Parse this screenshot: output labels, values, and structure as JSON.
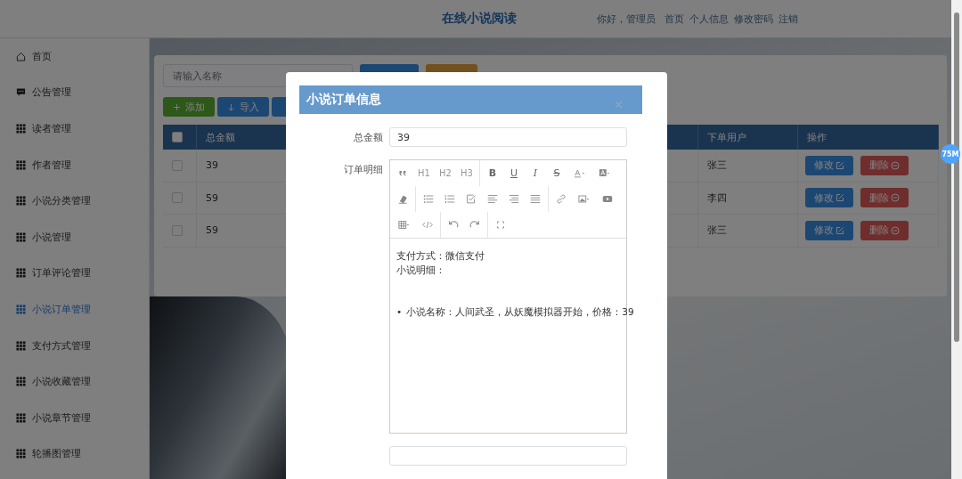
{
  "header": {
    "title": "在线小说阅读",
    "greeting": "你好，管理员",
    "links": [
      "首页",
      "个人信息",
      "修改密码",
      "注销"
    ]
  },
  "sidebar": {
    "items": [
      {
        "label": "首页",
        "kind": "home",
        "selected": false
      },
      {
        "label": "公告管理",
        "kind": "chat",
        "selected": false
      },
      {
        "label": "读者管理",
        "kind": "grid",
        "selected": false
      },
      {
        "label": "作者管理",
        "kind": "grid",
        "selected": false
      },
      {
        "label": "小说分类管理",
        "kind": "grid",
        "selected": false
      },
      {
        "label": "小说管理",
        "kind": "grid",
        "selected": false
      },
      {
        "label": "订单评论管理",
        "kind": "grid",
        "selected": false
      },
      {
        "label": "小说订单管理",
        "kind": "grid",
        "selected": true
      },
      {
        "label": "支付方式管理",
        "kind": "grid",
        "selected": false
      },
      {
        "label": "小说收藏管理",
        "kind": "grid",
        "selected": false
      },
      {
        "label": "小说章节管理",
        "kind": "grid",
        "selected": false
      },
      {
        "label": "轮播图管理",
        "kind": "grid",
        "selected": false
      }
    ]
  },
  "search": {
    "placeholder": "请输入名称",
    "buttons": [
      {
        "kind": "query"
      },
      {
        "kind": "reset"
      }
    ]
  },
  "toolbar": [
    {
      "kind": "add",
      "label": "添加"
    },
    {
      "kind": "import",
      "label": "导入"
    },
    {
      "kind": "export"
    }
  ],
  "table": {
    "columns": [
      "总金额",
      "下单用户",
      "操作"
    ],
    "select_all_checked": false,
    "rows": [
      {
        "checked": false,
        "amount": "39",
        "user": "张三",
        "actions": [
          {
            "kind": "edit",
            "label": "修改"
          },
          {
            "kind": "delete",
            "label": "删除"
          }
        ]
      },
      {
        "checked": false,
        "amount": "59",
        "user": "李四",
        "actions": [
          {
            "kind": "edit",
            "label": "修改"
          },
          {
            "kind": "delete",
            "label": "删除"
          }
        ]
      },
      {
        "checked": false,
        "amount": "59",
        "user": "张三",
        "actions": [
          {
            "kind": "edit",
            "label": "修改"
          },
          {
            "kind": "delete",
            "label": "删除"
          }
        ]
      }
    ]
  },
  "dialog": {
    "title": "小说订单信息",
    "fields": [
      {
        "label": "总金额",
        "kind": "input",
        "value": "39"
      },
      {
        "label": "订单明细",
        "kind": "editor"
      },
      {
        "kind": "input"
      }
    ],
    "editor": {
      "toolbar": [
        {
          "kind": "quote"
        },
        {
          "kind": "heading",
          "label": "H1"
        },
        {
          "kind": "heading",
          "label": "H2"
        },
        {
          "kind": "heading",
          "label": "H3"
        },
        {
          "kind": "divider"
        },
        {
          "kind": "bold",
          "label": "B"
        },
        {
          "kind": "underline",
          "label": "U"
        },
        {
          "kind": "italic",
          "label": "I"
        },
        {
          "kind": "strike",
          "label": "S"
        },
        {
          "kind": "font-color"
        },
        {
          "kind": "bg-color"
        },
        {
          "kind": "eraser"
        },
        {
          "kind": "divider"
        },
        {
          "kind": "bullet-list"
        },
        {
          "kind": "number-list"
        },
        {
          "kind": "todo"
        },
        {
          "kind": "align-left"
        },
        {
          "kind": "align-right"
        },
        {
          "kind": "justify"
        },
        {
          "kind": "divider"
        },
        {
          "kind": "link"
        },
        {
          "kind": "image"
        },
        {
          "kind": "video"
        },
        {
          "kind": "table"
        },
        {
          "kind": "code"
        },
        {
          "kind": "divider"
        },
        {
          "kind": "undo"
        },
        {
          "kind": "redo"
        },
        {
          "kind": "divider"
        },
        {
          "kind": "fullscreen"
        }
      ],
      "lines": [
        "支付方式：微信支付",
        "小说明细："
      ],
      "list": [
        {
          "marker": "•",
          "text": "小说名称：人间武圣，从妖魔模拟器开始，价格：39"
        }
      ]
    }
  },
  "badge": "75M"
}
